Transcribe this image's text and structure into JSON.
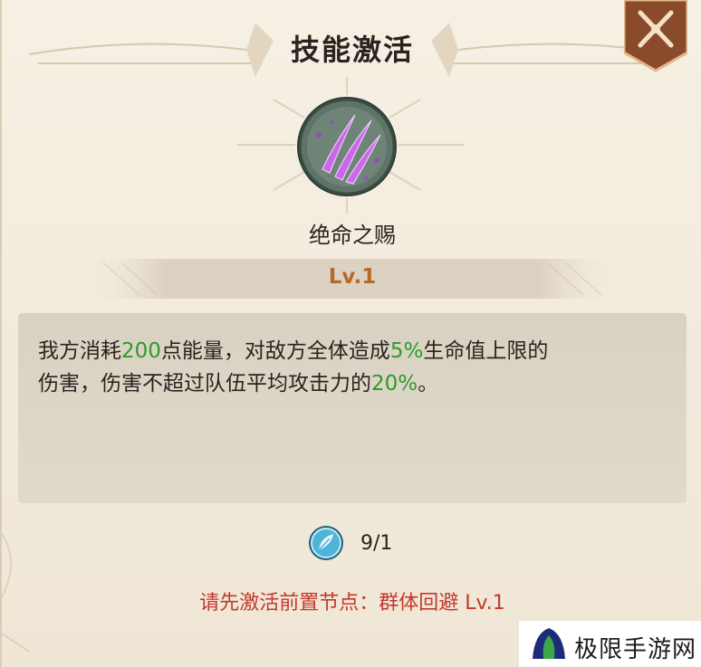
{
  "dialog": {
    "title": "技能激活",
    "skill_name": "绝命之赐",
    "level": "Lv.1",
    "description": {
      "line1": [
        {
          "text": "我方消耗",
          "hl": false
        },
        {
          "text": "200",
          "hl": true
        },
        {
          "text": "点能量，对敌方全体造成",
          "hl": false
        },
        {
          "text": "5%",
          "hl": true
        },
        {
          "text": "生命值上限的",
          "hl": false
        }
      ],
      "line2": [
        {
          "text": "伤害，伤害不超过队伍平均攻击力的",
          "hl": false
        },
        {
          "text": "20%",
          "hl": true
        },
        {
          "text": "。",
          "hl": false
        }
      ]
    },
    "cost": "9/1",
    "requirement": "请先激活前置节点：群体回避 Lv.1",
    "icons": {
      "close": "close-crossed-swords-icon",
      "skill": "purple-claw-slash-icon",
      "cost": "feather-gem-icon"
    },
    "colors": {
      "highlight": "#2e9a2a",
      "level": "#b6692b",
      "warning": "#c4382c"
    }
  },
  "watermark": {
    "text": "极限手游网"
  }
}
